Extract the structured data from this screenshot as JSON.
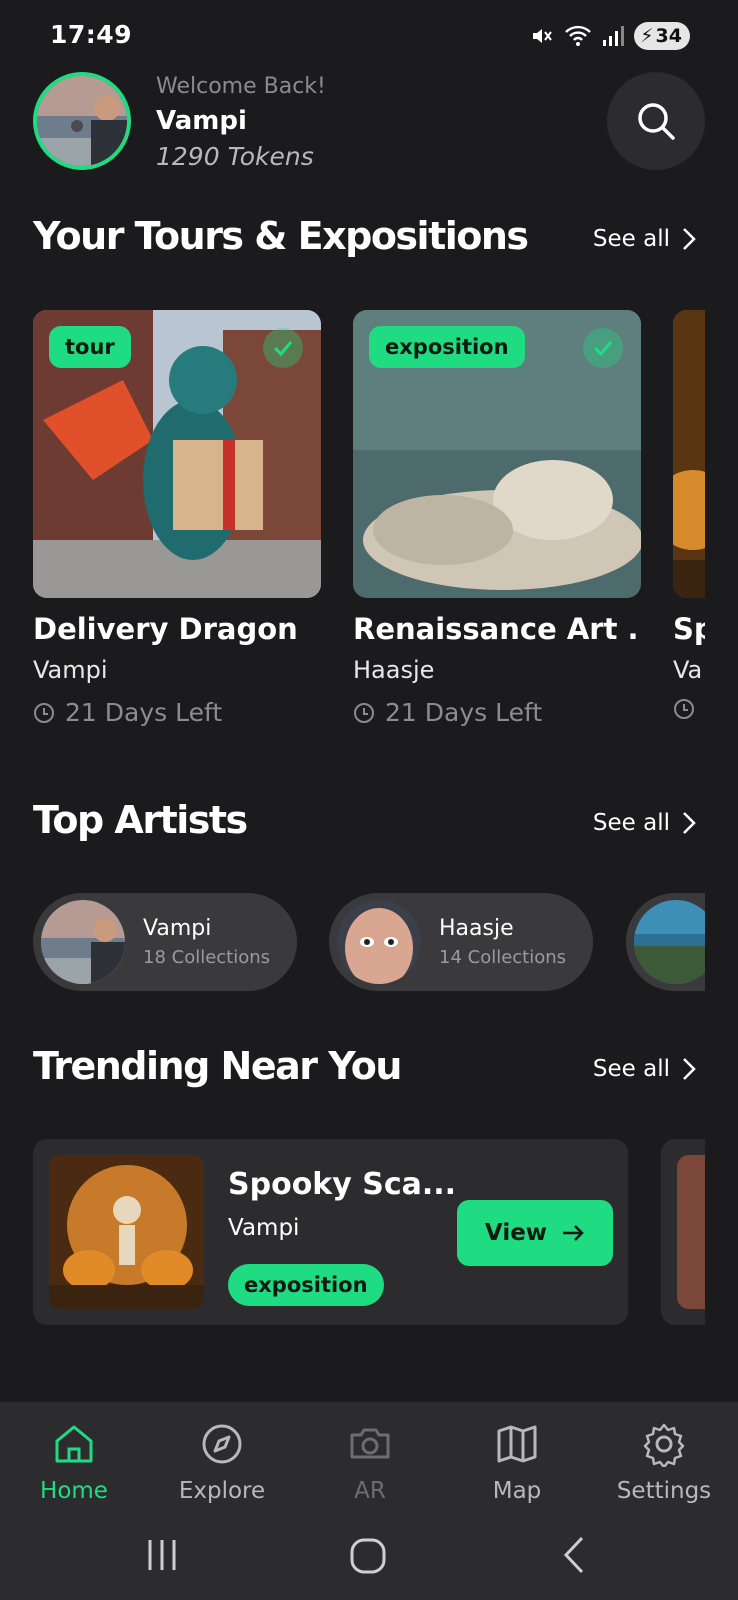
{
  "status_bar": {
    "time": "17:49",
    "battery": "34"
  },
  "header": {
    "welcome": "Welcome Back!",
    "username": "Vampi",
    "tokens": "1290 Tokens"
  },
  "sections": {
    "tours": {
      "title": "Your Tours & Expositions",
      "see_all": "See all"
    },
    "artists": {
      "title": "Top Artists",
      "see_all": "See all"
    },
    "trending": {
      "title": "Trending Near You",
      "see_all": "See all"
    }
  },
  "tours": [
    {
      "badge": "tour",
      "title": "Delivery Dragon",
      "author": "Vampi",
      "days": "21 Days Left"
    },
    {
      "badge": "exposition",
      "title": "Renaissance Art ...",
      "author": "Haasje",
      "days": "21 Days Left"
    },
    {
      "title": "Sp",
      "author": "Va"
    }
  ],
  "artists": [
    {
      "name": "Vampi",
      "collections": "18 Collections"
    },
    {
      "name": "Haasje",
      "collections": "14 Collections"
    }
  ],
  "trending": [
    {
      "title": "Spooky Sca...",
      "author": "Vampi",
      "badge": "exposition",
      "action": "View"
    }
  ],
  "bottom_nav": [
    {
      "label": "Home",
      "icon": "home-icon",
      "state": "active"
    },
    {
      "label": "Explore",
      "icon": "compass-icon",
      "state": "normal"
    },
    {
      "label": "AR",
      "icon": "camera-icon",
      "state": "disabled"
    },
    {
      "label": "Map",
      "icon": "map-icon",
      "state": "normal"
    },
    {
      "label": "Settings",
      "icon": "gear-icon",
      "state": "normal"
    }
  ],
  "colors": {
    "accent": "#1fdc82",
    "background": "#1b1b1d",
    "card": "#2c2c2f"
  }
}
